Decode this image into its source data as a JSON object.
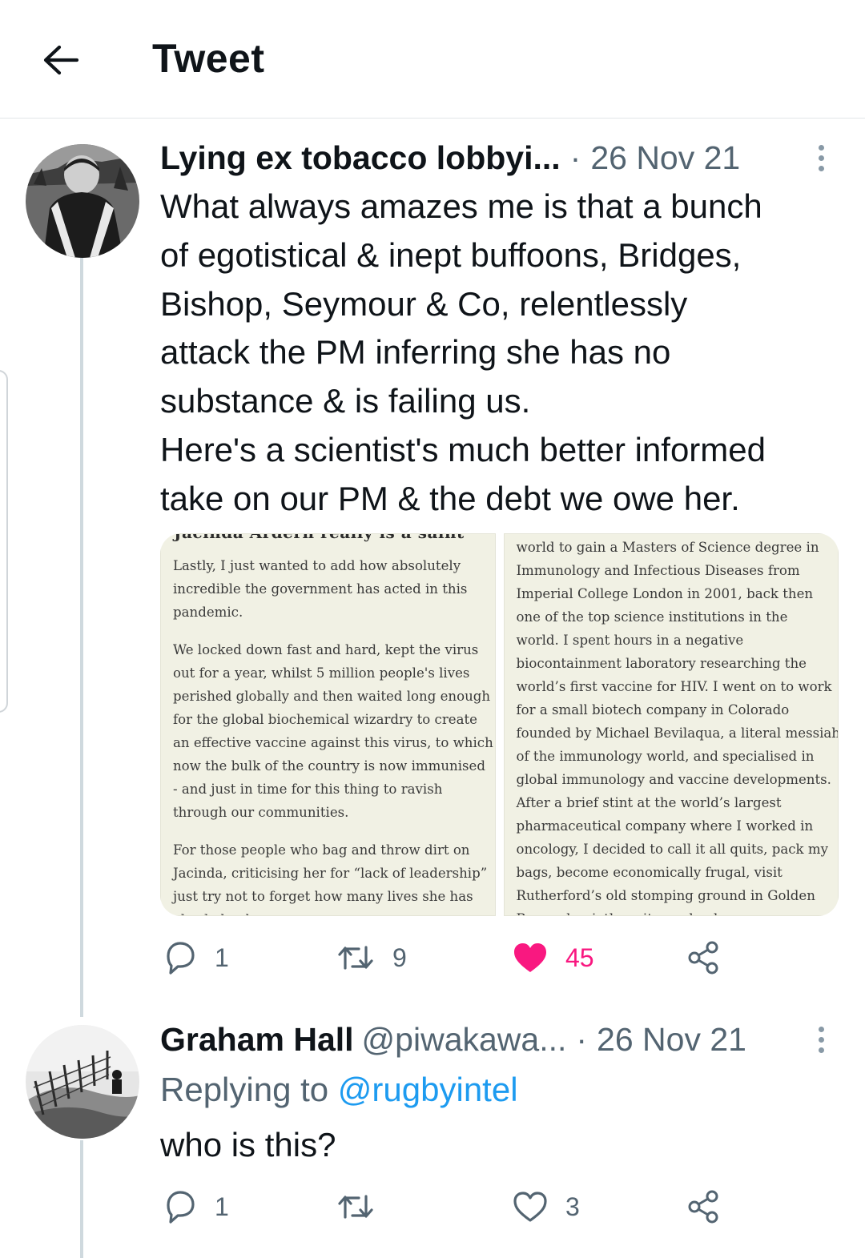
{
  "header": {
    "title": "Tweet"
  },
  "tweets": [
    {
      "author": "Lying ex tobacco lobbyi...",
      "separator": "·",
      "date": "26 Nov 21",
      "text_lines": [
        "What always amazes me is that a bunch",
        "of egotistical & inept buffoons, Bridges,",
        "Bishop, Seymour & Co, relentlessly",
        "attack the PM inferring she has no",
        "substance & is failing us.",
        "Here's a scientist's much better informed",
        "take on our PM & the debt we owe her."
      ],
      "media": {
        "left": {
          "heading_fragment": "Jacinda Ardern really is a saint",
          "paragraphs": [
            [
              "Lastly, I just wanted to add how absolutely",
              "incredible the government has acted in this",
              "pandemic."
            ],
            [
              "We locked down fast and hard, kept the virus",
              "out for a year, whilst 5 million people's lives",
              "perished globally and then waited long enough",
              "for the global biochemical wizardry to create",
              "an effective vaccine against this virus, to which",
              "now the bulk of the country is now immunised",
              "- and just in time for this thing to ravish",
              "through our communities."
            ],
            [
              "For those people who bag and throw dirt on",
              "Jacinda, criticising her for “lack of leadership”",
              "just try not to forget how many lives she has",
              "also helped"
            ]
          ]
        },
        "right": {
          "lines": [
            "world to gain a Masters of Science degree in",
            "Immunology and Infectious Diseases from",
            "Imperial College London in 2001, back then",
            "one of the top science institutions in the",
            "world. I spent hours in a negative",
            "biocontainment laboratory researching the",
            "world’s first vaccine for HIV. I went on to work",
            "for a small biotech company in Colorado",
            "founded by Michael Bevilaqua, a literal messiah",
            "of the immunology world, and specialised in",
            "global immunology and vaccine developments.",
            "After a brief stint at the world’s largest",
            "pharmaceutical company where I worked in",
            "oncology, I decided to call it all quits, pack my",
            "bags, become economically frugal, visit",
            "Rutherford’s old stomping ground in Golden",
            "Bay and quietly write my book"
          ]
        }
      },
      "actions": {
        "replies": "1",
        "retweets": "9",
        "likes": "45",
        "liked": true
      }
    },
    {
      "author": "Graham Hall",
      "handle": "@piwakawa...",
      "separator": "·",
      "date": "26 Nov 21",
      "replying_prefix": "Replying to ",
      "replying_to": "@rugbyintel",
      "text": "who is this?",
      "actions": {
        "replies": "1",
        "retweets": "",
        "likes": "3",
        "liked": false
      }
    }
  ],
  "colors": {
    "accent": "#1d9bf0",
    "like": "#f91880",
    "muted": "#536471",
    "thread_line": "#cfd9de"
  },
  "icons": [
    "back-arrow-icon",
    "more-vertical-icon",
    "reply-icon",
    "retweet-icon",
    "heart-icon",
    "share-icon"
  ]
}
